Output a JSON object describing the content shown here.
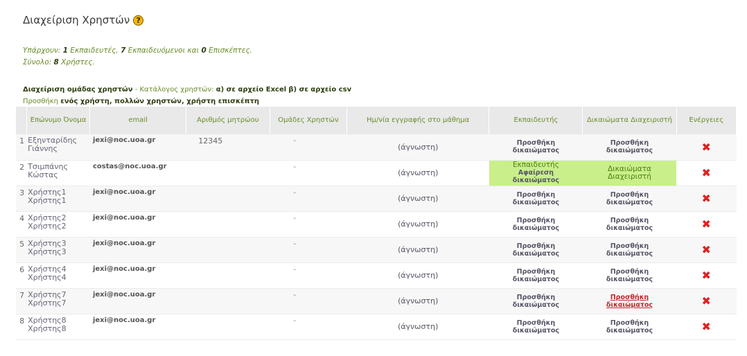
{
  "page": {
    "title": "Διαχείριση Χρηστών",
    "help_icon": "?"
  },
  "summary": {
    "line1": {
      "pre": "Υπάρχουν: ",
      "teachers_count": "1",
      "teachers_label": " Εκπαιδευτές, ",
      "students_count": "7",
      "students_label": " Εκπαιδευόμενοι και ",
      "guests_count": "0",
      "guests_label": " Επισκέπτες."
    },
    "line2": {
      "pre": "Σύνολο: ",
      "total_count": "8",
      "total_label": " Χρήστες."
    }
  },
  "management": {
    "group_link": "Διαχείριση ομάδας χρηστών",
    "separator": " - ",
    "catalog_label": "Κατάλογος χρηστών: ",
    "excel_link": "α) σε αρχείο Excel",
    "csv_link": "β) σε αρχείο csv",
    "add_label": "Προσθήκη ",
    "add_one": "ενός χρήστη",
    "add_many": "πολλών χρηστών",
    "add_guest": "χρήστη επισκέπτη"
  },
  "table": {
    "headers": {
      "name": "Επώνυμο Όνομα",
      "email": "email",
      "am": "Αριθμός μητρώου",
      "groups": "Ομάδες Χρηστών",
      "date": "Ημ/νία εγγραφής στο μάθημα",
      "role": "Εκπαιδευτής",
      "admin": "Δικαιώματα Διαχειριστή",
      "actions": "Ενέργειες"
    },
    "rows": [
      {
        "num": "1",
        "surname": "Εξηνταρίδης",
        "first": "Γιάννης",
        "email": "jexi@noc.uoa.gr",
        "am": "12345",
        "groups": "-",
        "date": "(άγνωστη)",
        "role_line1": "Προσθήκη",
        "role_line2": "δικαιώματος",
        "admin_line1": "Προσθήκη",
        "admin_line2": "δικαιώματος",
        "delete": "✖"
      },
      {
        "num": "2",
        "surname": "Τσιμπάνης",
        "first": "Κώστας",
        "email": "costas@noc.uoa.gr",
        "am": "",
        "groups": "-",
        "date": "(άγνωστη)",
        "role_line1": "Εκπαιδευτής",
        "role_line2": "Αφαίρεση",
        "role_line3": "δικαιώματος",
        "admin_line1": "Δικαιώματα",
        "admin_line2": "Διαχειριστή",
        "delete": "✖"
      },
      {
        "num": "3",
        "surname": "Χρήστης1",
        "first": "Χρήστης1",
        "email": "jexi@noc.uoa.gr",
        "am": "",
        "groups": "-",
        "date": "(άγνωστη)",
        "role_line1": "Προσθήκη",
        "role_line2": "δικαιώματος",
        "admin_line1": "Προσθήκη",
        "admin_line2": "δικαιώματος",
        "delete": "✖"
      },
      {
        "num": "4",
        "surname": "Χρήστης2",
        "first": "Χρήστης2",
        "email": "jexi@noc.uoa.gr",
        "am": "",
        "groups": "-",
        "date": "(άγνωστη)",
        "role_line1": "Προσθήκη",
        "role_line2": "δικαιώματος",
        "admin_line1": "Προσθήκη",
        "admin_line2": "δικαιώματος",
        "delete": "✖"
      },
      {
        "num": "5",
        "surname": "Χρήστης3",
        "first": "Χρήστης3",
        "email": "jexi@noc.uoa.gr",
        "am": "",
        "groups": "-",
        "date": "(άγνωστη)",
        "role_line1": "Προσθήκη",
        "role_line2": "δικαιώματος",
        "admin_line1": "Προσθήκη",
        "admin_line2": "δικαιώματος",
        "delete": "✖"
      },
      {
        "num": "6",
        "surname": "Χρήστης4",
        "first": "Χρήστης4",
        "email": "jexi@noc.uoa.gr",
        "am": "",
        "groups": "-",
        "date": "(άγνωστη)",
        "role_line1": "Προσθήκη",
        "role_line2": "δικαιώματος",
        "admin_line1": "Προσθήκη",
        "admin_line2": "δικαιώματος",
        "delete": "✖"
      },
      {
        "num": "7",
        "surname": "Χρήστης7",
        "first": "Χρήστης7",
        "email": "jexi@noc.uoa.gr",
        "am": "",
        "groups": "-",
        "date": "(άγνωστη)",
        "role_line1": "Προσθήκη",
        "role_line2": "δικαιώματος",
        "admin_line1": "Προσθήκη",
        "admin_line2": "δικαιώματος",
        "delete": "✖"
      },
      {
        "num": "8",
        "surname": "Χρήστης8",
        "first": "Χρήστης8",
        "email": "jexi@noc.uoa.gr",
        "am": "",
        "groups": "-",
        "date": "(άγνωστη)",
        "role_line1": "Προσθήκη",
        "role_line2": "δικαιώματος",
        "admin_line1": "Προσθήκη",
        "admin_line2": "δικαιώματος",
        "delete": "✖"
      }
    ]
  },
  "colors": {
    "accent_green": "#6b8a2a",
    "highlight_green": "#c9ef8a",
    "delete_red": "#e02020",
    "hover_link_red": "#c0272d"
  }
}
